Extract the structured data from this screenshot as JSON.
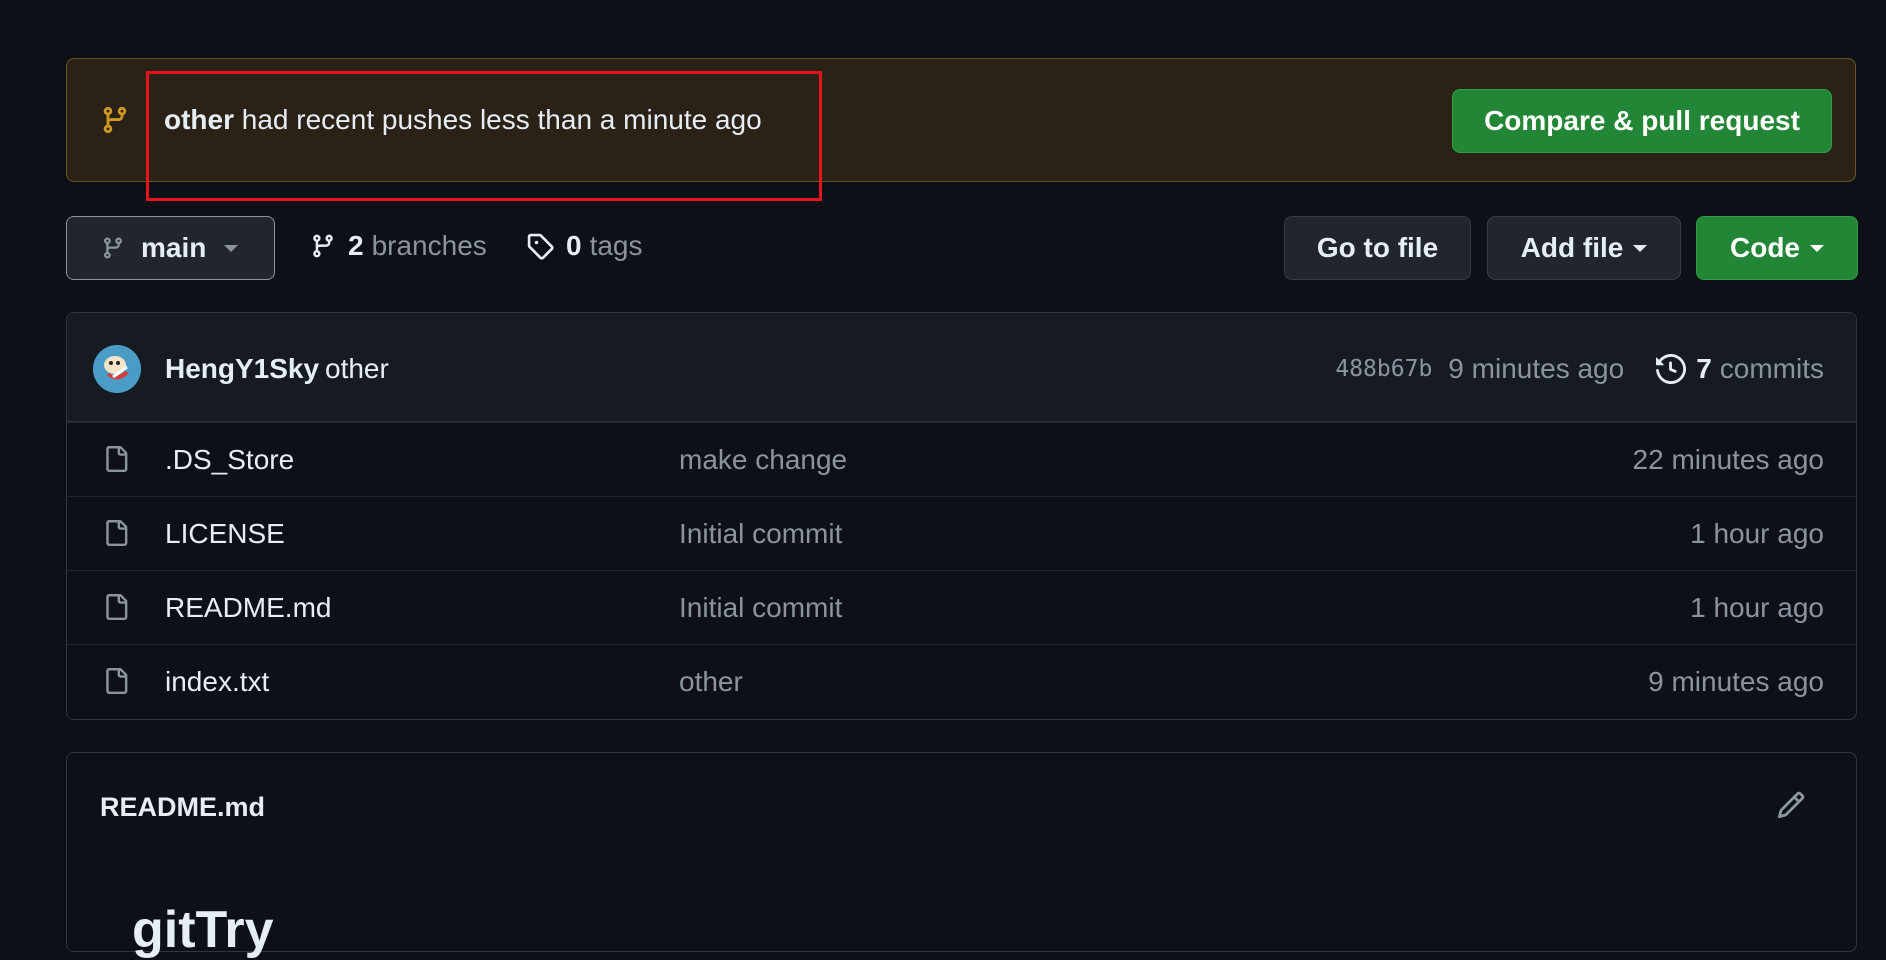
{
  "banner": {
    "branch": "other",
    "message": "had recent pushes less than a minute ago",
    "compare_button": "Compare & pull request"
  },
  "toolbar": {
    "current_branch": "main",
    "branches_count": "2",
    "branches_label": "branches",
    "tags_count": "0",
    "tags_label": "tags",
    "goto_file": "Go to file",
    "add_file": "Add file",
    "code": "Code"
  },
  "latest_commit": {
    "author": "HengY1Sky",
    "message": "other",
    "sha": "488b67b",
    "time": "9 minutes ago",
    "commits_count": "7",
    "commits_label": "commits"
  },
  "files": [
    {
      "name": ".DS_Store",
      "message": "make change",
      "time": "22 minutes ago"
    },
    {
      "name": "LICENSE",
      "message": "Initial commit",
      "time": "1 hour ago"
    },
    {
      "name": "README.md",
      "message": "Initial commit",
      "time": "1 hour ago"
    },
    {
      "name": "index.txt",
      "message": "other",
      "time": "9 minutes ago"
    }
  ],
  "readme": {
    "title": "README.md",
    "heading": "gitTry"
  },
  "icons": {
    "branch": "git-branch-icon",
    "tag": "tag-icon",
    "file": "file-icon",
    "history": "history-icon",
    "edit": "pencil-icon"
  },
  "colors": {
    "background": "#0d1117",
    "green_button": "#238636",
    "banner_bg": "#2a2117",
    "highlight": "#e5141c",
    "muted_text": "#8b949e",
    "branch_icon_banner": "#d29922"
  }
}
